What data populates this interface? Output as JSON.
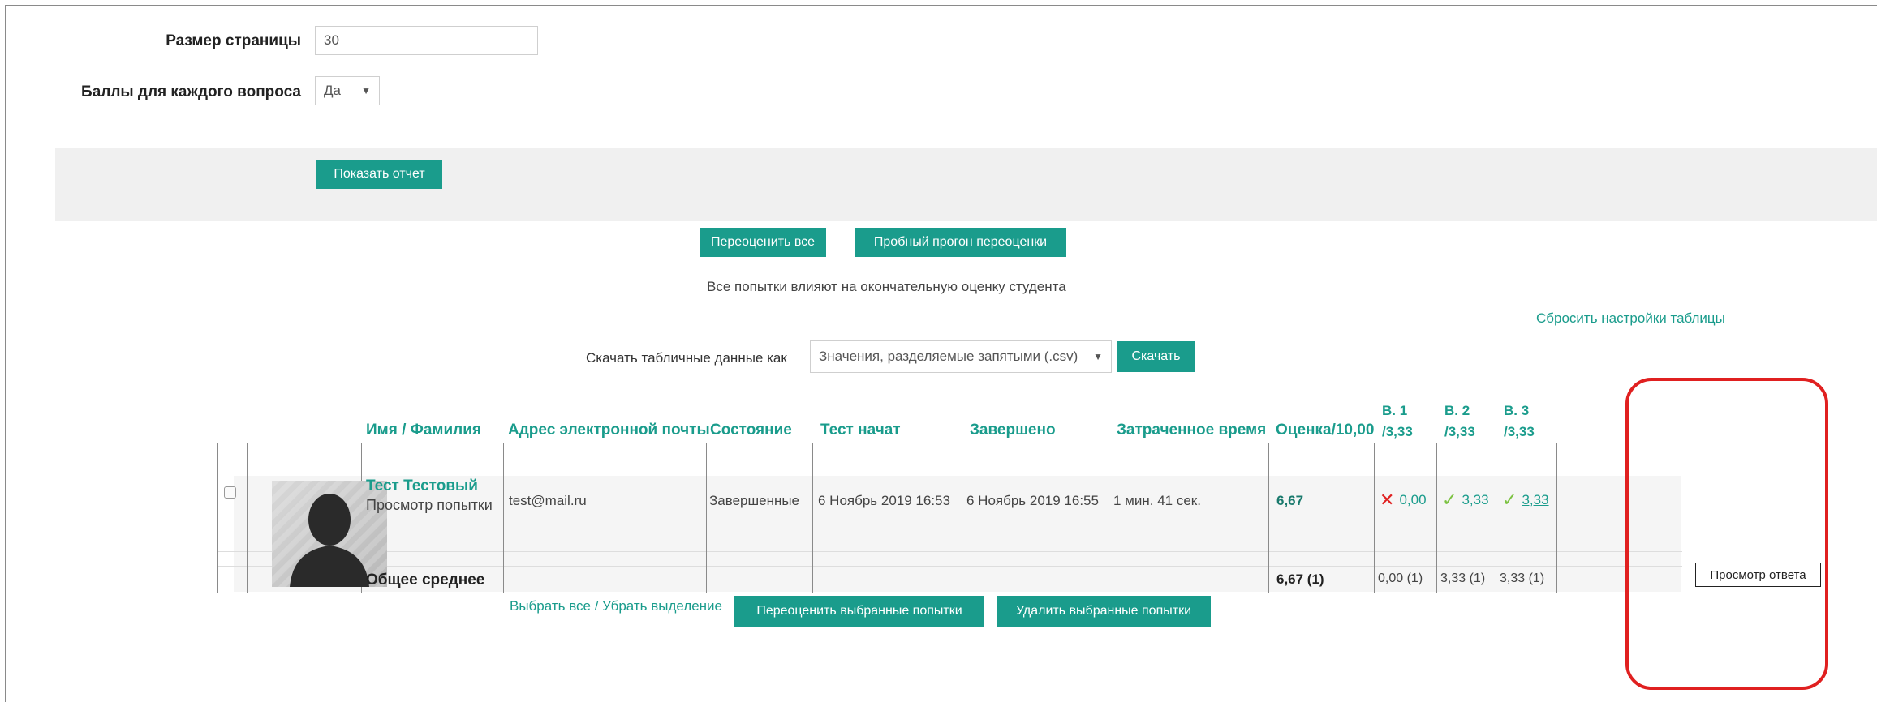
{
  "form": {
    "page_size_label": "Размер страницы",
    "page_size_value": "30",
    "marks_label": "Баллы для каждого вопроса",
    "marks_value": "Да",
    "show_report": "Показать отчет"
  },
  "actions": {
    "regrade_all": "Переоценить все",
    "dry_run": "Пробный прогон переоценки",
    "note": "Все попытки влияют на окончательную оценку студента",
    "reset_table": "Сбросить настройки таблицы",
    "download_label": "Скачать табличные данные как",
    "download_format": "Значения, разделяемые запятыми (.csv)",
    "download_btn": "Скачать"
  },
  "table": {
    "headers": {
      "name": "Имя / Фамилия",
      "email": "Адрес электронной почты",
      "state": "Состояние",
      "started": "Тест начат",
      "finished": "Завершено",
      "time": "Затраченное время",
      "grade": "Оценка/10,00",
      "q1_a": "В. 1",
      "q1_b": "/3,33",
      "q2_a": "В. 2",
      "q2_b": "/3,33",
      "q3_a": "В. 3",
      "q3_b": "/3,33"
    },
    "row": {
      "name": "Тест Тестовый",
      "review": "Просмотр попытки",
      "email": "test@mail.ru",
      "state": "Завершенные",
      "started": "6 Ноябрь 2019 16:53",
      "finished": "6 Ноябрь 2019 16:55",
      "time": "1 мин. 41 сек.",
      "grade": "6,67",
      "q1": "0,00",
      "q2": "3,33",
      "q3": "3,33"
    },
    "avg": {
      "label": "Общее среднее",
      "grade": "6,67 (1)",
      "q1": "0,00 (1)",
      "q2": "3,33 (1)",
      "q3": "3,33 (1)"
    }
  },
  "tooltip": "Просмотр ответа",
  "bottom": {
    "select_all": "Выбрать все / Убрать выделение",
    "regrade_selected": "Переоценить выбранные попытки",
    "delete_selected": "Удалить выбранные попытки"
  },
  "icons": {
    "wrong": "cross-icon",
    "correct": "check-icon"
  },
  "colors": {
    "accent": "#1a9c8c",
    "wrong": "#e02020",
    "correct": "#7cc242",
    "highlight": "#e02020"
  }
}
